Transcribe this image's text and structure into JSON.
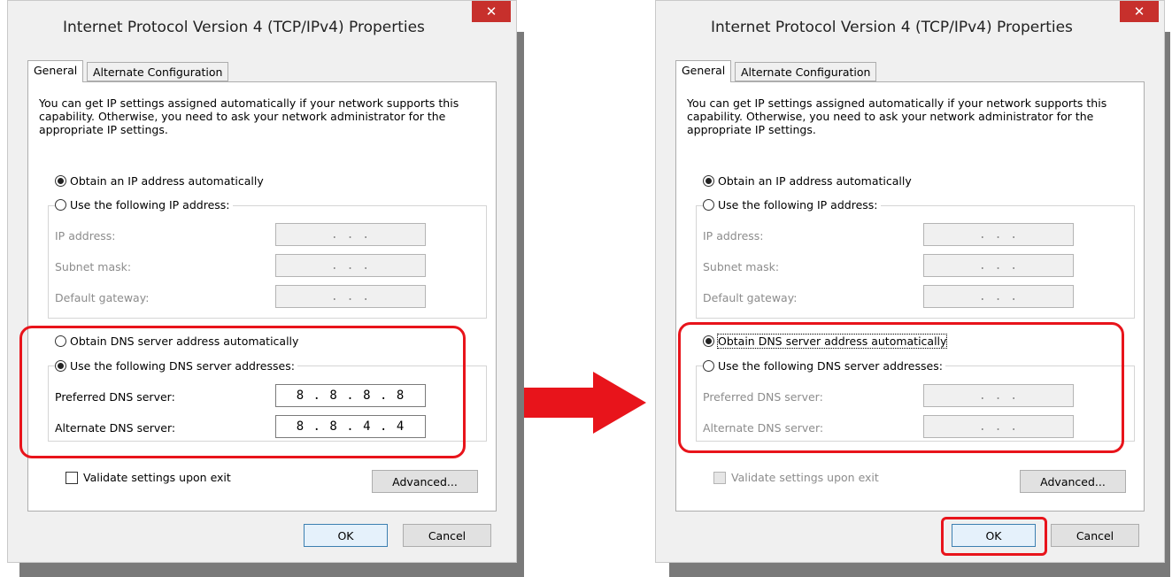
{
  "dialog": {
    "title": "Internet Protocol Version 4 (TCP/IPv4) Properties",
    "close_label": "✕",
    "tabs": [
      "General",
      "Alternate Configuration"
    ],
    "description": "You can get IP settings assigned automatically if your network supports this capability. Otherwise, you need to ask your network administrator for the appropriate IP settings.",
    "ip_auto_label": "Obtain an IP address automatically",
    "ip_manual_label": "Use the following IP address:",
    "ip_address_label": "IP address:",
    "subnet_label": "Subnet mask:",
    "gateway_label": "Default gateway:",
    "empty_ip": ".    .    .",
    "dns_auto_label": "Obtain DNS server address automatically",
    "dns_manual_label": "Use the following DNS server addresses:",
    "preferred_dns_label": "Preferred DNS server:",
    "alternate_dns_label": "Alternate DNS server:",
    "validate_label": "Validate settings upon exit",
    "advanced_label": "Advanced...",
    "ok_label": "OK",
    "cancel_label": "Cancel"
  },
  "before": {
    "preferred_dns": "8 . 8 . 8 . 8",
    "alternate_dns": "8 . 8 . 4 . 4"
  },
  "colors": {
    "highlight": "#e8141b",
    "close_button": "#c7302c",
    "arrow": "#e8141b"
  }
}
